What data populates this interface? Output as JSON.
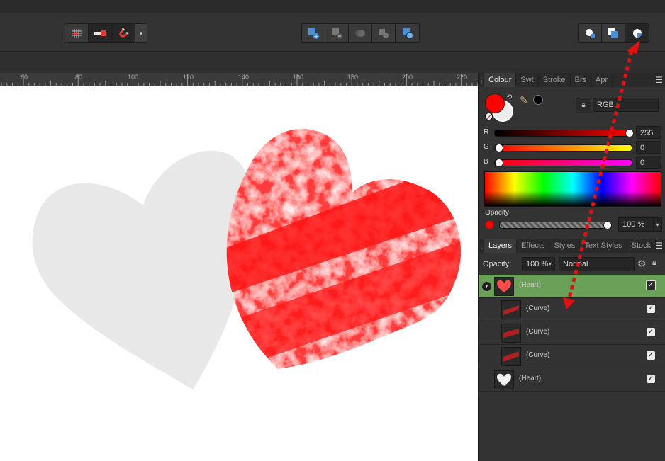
{
  "toolbar": {
    "snapping_buttons": [
      "snapping-grid-icon",
      "snapping-options-icon",
      "snapping-magnet-icon"
    ],
    "boolean_buttons": [
      "add-icon",
      "subtract-icon",
      "intersect-icon",
      "xor-icon",
      "divide-icon"
    ],
    "insert_buttons": [
      "insert-behind-icon",
      "insert-top-icon",
      "insert-inside-icon"
    ],
    "dropdown_glyph": "▾"
  },
  "ruler": {
    "labels": [
      "60",
      "80",
      "100",
      "120",
      "140",
      "160",
      "180",
      "200",
      "220"
    ]
  },
  "colour_panel": {
    "tabs": [
      "Colour",
      "Swt",
      "Stroke",
      "Brs",
      "Apr"
    ],
    "active_tab": "Colour",
    "model": "RGB",
    "r_label": "R",
    "r_value": "255",
    "g_label": "G",
    "g_value": "0",
    "b_label": "B",
    "b_value": "0",
    "opacity_label": "Opacity",
    "opacity_value": "100 %",
    "fill_color": "#ff0000"
  },
  "layers_panel": {
    "tabs": [
      "Layers",
      "Effects",
      "Styles",
      "Text Styles",
      "Stock"
    ],
    "active_tab": "Layers",
    "opacity_label": "Opacity:",
    "opacity_value": "100 %",
    "blend_mode": "Normal",
    "layers": [
      {
        "name": "(Heart)",
        "selected": true
      },
      {
        "name": "(Curve)",
        "selected": false
      },
      {
        "name": "(Curve)",
        "selected": false
      },
      {
        "name": "(Curve)",
        "selected": false
      },
      {
        "name": "(Heart)",
        "selected": false
      }
    ],
    "check_glyph": "✓",
    "expand_glyph": "▼"
  },
  "colors": {
    "selection_green": "#6ba058",
    "annotation_red": "#e11111",
    "ghost_heart": "#e8e8e8"
  }
}
